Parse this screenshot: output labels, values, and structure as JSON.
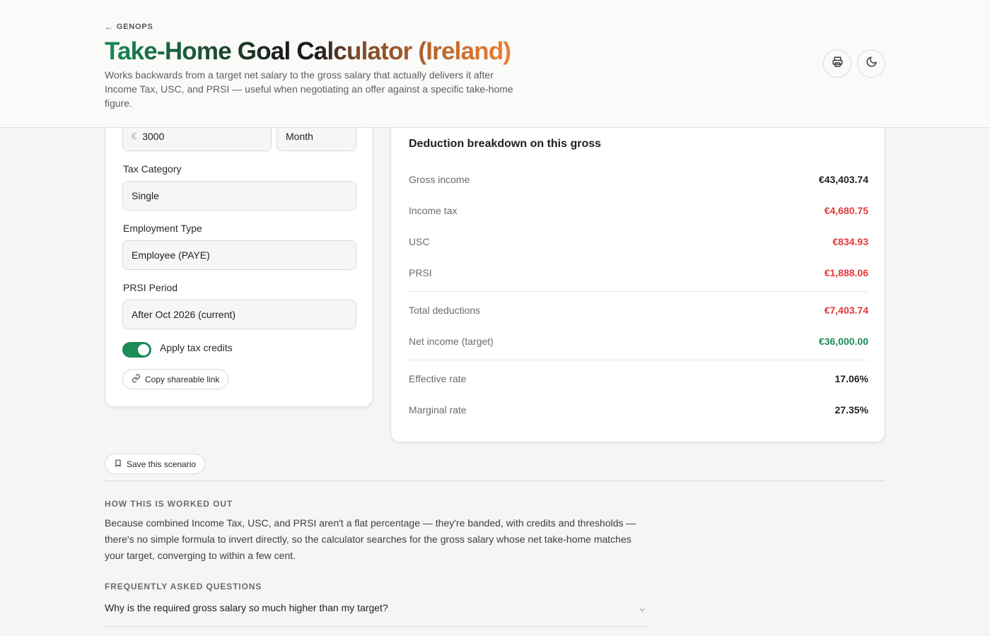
{
  "header": {
    "back_label": "GENOPS",
    "title": "Take-Home Goal Calculator (Ireland)",
    "subtitle": "Works backwards from a target net salary to the gross salary that actually delivers it after Income Tax, USC, and PRSI — useful when negotiating an offer against a specific take-home figure.",
    "print_icon": "printer-icon",
    "theme_icon": "moon-icon"
  },
  "inputs": {
    "currency_symbol": "€",
    "amount_value": "3000",
    "period_value": "Month",
    "tax_category_label": "Tax Category",
    "tax_category_value": "Single",
    "employment_type_label": "Employment Type",
    "employment_type_value": "Employee (PAYE)",
    "prsi_period_label": "PRSI Period",
    "prsi_period_value": "After Oct 2026 (current)",
    "apply_credits_label": "Apply tax credits",
    "apply_credits_on": true,
    "copy_link_label": "Copy shareable link"
  },
  "breakdown": {
    "title": "Deduction breakdown on this gross",
    "rows": [
      {
        "label": "Gross income",
        "value": "€43,403.74"
      },
      {
        "label": "Income tax",
        "value": "€4,680.75"
      },
      {
        "label": "USC",
        "value": "€834.93"
      },
      {
        "label": "PRSI",
        "value": "€1,888.06"
      },
      {
        "label": "Total deductions",
        "value": "€7,403.74"
      },
      {
        "label": "Net income (target)",
        "value": "€36,000.00"
      },
      {
        "label": "Effective rate",
        "value": "17.06%"
      },
      {
        "label": "Marginal rate",
        "value": "27.35%"
      }
    ]
  },
  "actions": {
    "save_label": "Save this scenario"
  },
  "how_section": {
    "heading": "HOW THIS IS WORKED OUT",
    "body": "Because combined Income Tax, USC, and PRSI aren't a flat percentage — they're banded, with credits and thresholds — there's no simple formula to invert directly, so the calculator searches for the gross salary whose net take-home matches your target, converging to within a few cent."
  },
  "faq": {
    "heading": "FREQUENTLY ASKED QUESTIONS",
    "items": [
      {
        "question": "Why is the required gross salary so much higher than my target?"
      }
    ]
  },
  "colors": {
    "accent_green": "#1c8b57",
    "deduction_red": "#e03b3b",
    "title_orange": "#f07f31"
  }
}
